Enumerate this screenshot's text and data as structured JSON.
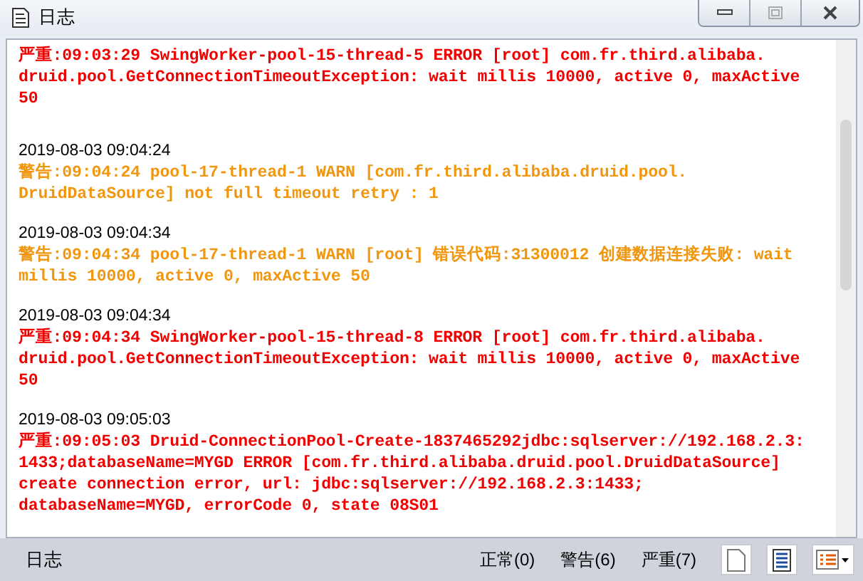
{
  "window": {
    "title": "日志"
  },
  "entries": [
    {
      "kind": "error",
      "lines": [
        "严重:09:03:29 SwingWorker-pool-15-thread-5 ERROR [root] com.fr.third.alibaba.",
        "druid.pool.GetConnectionTimeoutException: wait millis 10000, active 0, maxActive",
        "50"
      ]
    },
    {
      "kind": "warn",
      "timestamp": "2019-08-03 09:04:24",
      "lines": [
        "警告:09:04:24 pool-17-thread-1 WARN [com.fr.third.alibaba.druid.pool.",
        "DruidDataSource] not full timeout retry : 1"
      ]
    },
    {
      "kind": "warn",
      "timestamp": "2019-08-03 09:04:34",
      "lines": [
        "警告:09:04:34 pool-17-thread-1 WARN [root] 错误代码:31300012 创建数据连接失败: wait",
        "millis 10000, active 0, maxActive 50"
      ]
    },
    {
      "kind": "error",
      "timestamp": "2019-08-03 09:04:34",
      "lines": [
        "严重:09:04:34 SwingWorker-pool-15-thread-8 ERROR [root] com.fr.third.alibaba.",
        "druid.pool.GetConnectionTimeoutException: wait millis 10000, active 0, maxActive",
        "50"
      ]
    },
    {
      "kind": "error",
      "timestamp": "2019-08-03 09:05:03",
      "lines": [
        "严重:09:05:03 Druid-ConnectionPool-Create-1837465292jdbc:sqlserver://192.168.2.3:",
        "1433;databaseName=MYGD ERROR [com.fr.third.alibaba.druid.pool.DruidDataSource]",
        "create connection error, url: jdbc:sqlserver://192.168.2.3:1433;",
        "databaseName=MYGD, errorCode 0, state 08S01"
      ]
    }
  ],
  "status_bar": {
    "label": "日志",
    "filters": [
      "正常(0)",
      "警告(6)",
      "严重(7)"
    ]
  }
}
